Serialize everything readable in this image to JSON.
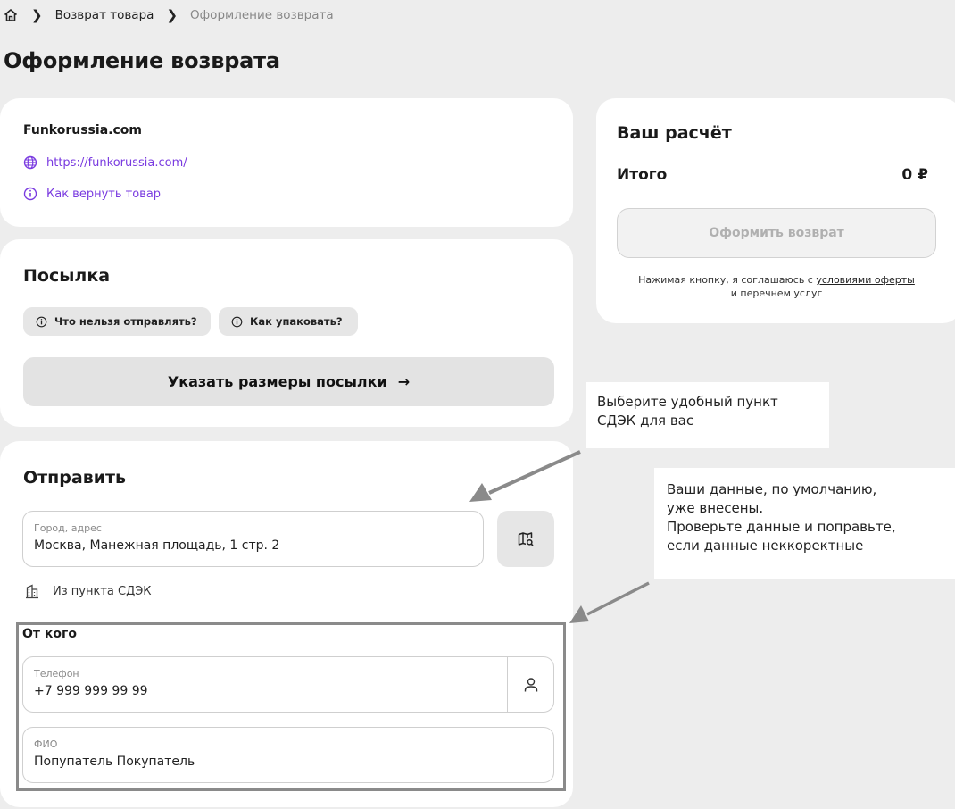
{
  "breadcrumb": {
    "items": [
      "Возврат товара",
      "Оформление возврата"
    ]
  },
  "page": {
    "title": "Оформление возврата"
  },
  "shop": {
    "name": "Funkorussia.com",
    "site": "https://funkorussia.com/",
    "howto": "Как вернуть товар",
    "link_color": "#7a3be0"
  },
  "parcel": {
    "title": "Посылка",
    "chips": [
      "Что нельзя отправлять?",
      "Как упаковать?"
    ],
    "size_button": "Указать размеры посылки",
    "size_button_arrow": "→"
  },
  "send": {
    "title": "Отправить",
    "address": {
      "label": "Город, адрес",
      "value": "Москва, Манежная площадь, 1 стр. 2"
    },
    "pickup": "Из пункта СДЭК",
    "from_title": "От кого",
    "phone": {
      "label": "Телефон",
      "value": "+7 999 999 99 99"
    },
    "name": {
      "label": "ФИО",
      "value": "Попупатель Покупатель"
    }
  },
  "calc": {
    "title": "Ваш расчёт",
    "total_label": "Итого",
    "total_value": "0 ₽",
    "button": "Оформить возврат",
    "terms_prefix": "Нажимая кнопку, я соглашаюсь с ",
    "terms_link": "условиями оферты",
    "terms_suffix": "и перечнем услуг"
  },
  "annotations": {
    "callout_1": [
      "Выберите удобный пункт",
      "СДЭК для вас"
    ],
    "callout_2": [
      "Ваши данные, по умолчанию,",
      "уже внесены.",
      "Проверьте данные и поправьте,",
      "если данные неккоректные"
    ]
  }
}
